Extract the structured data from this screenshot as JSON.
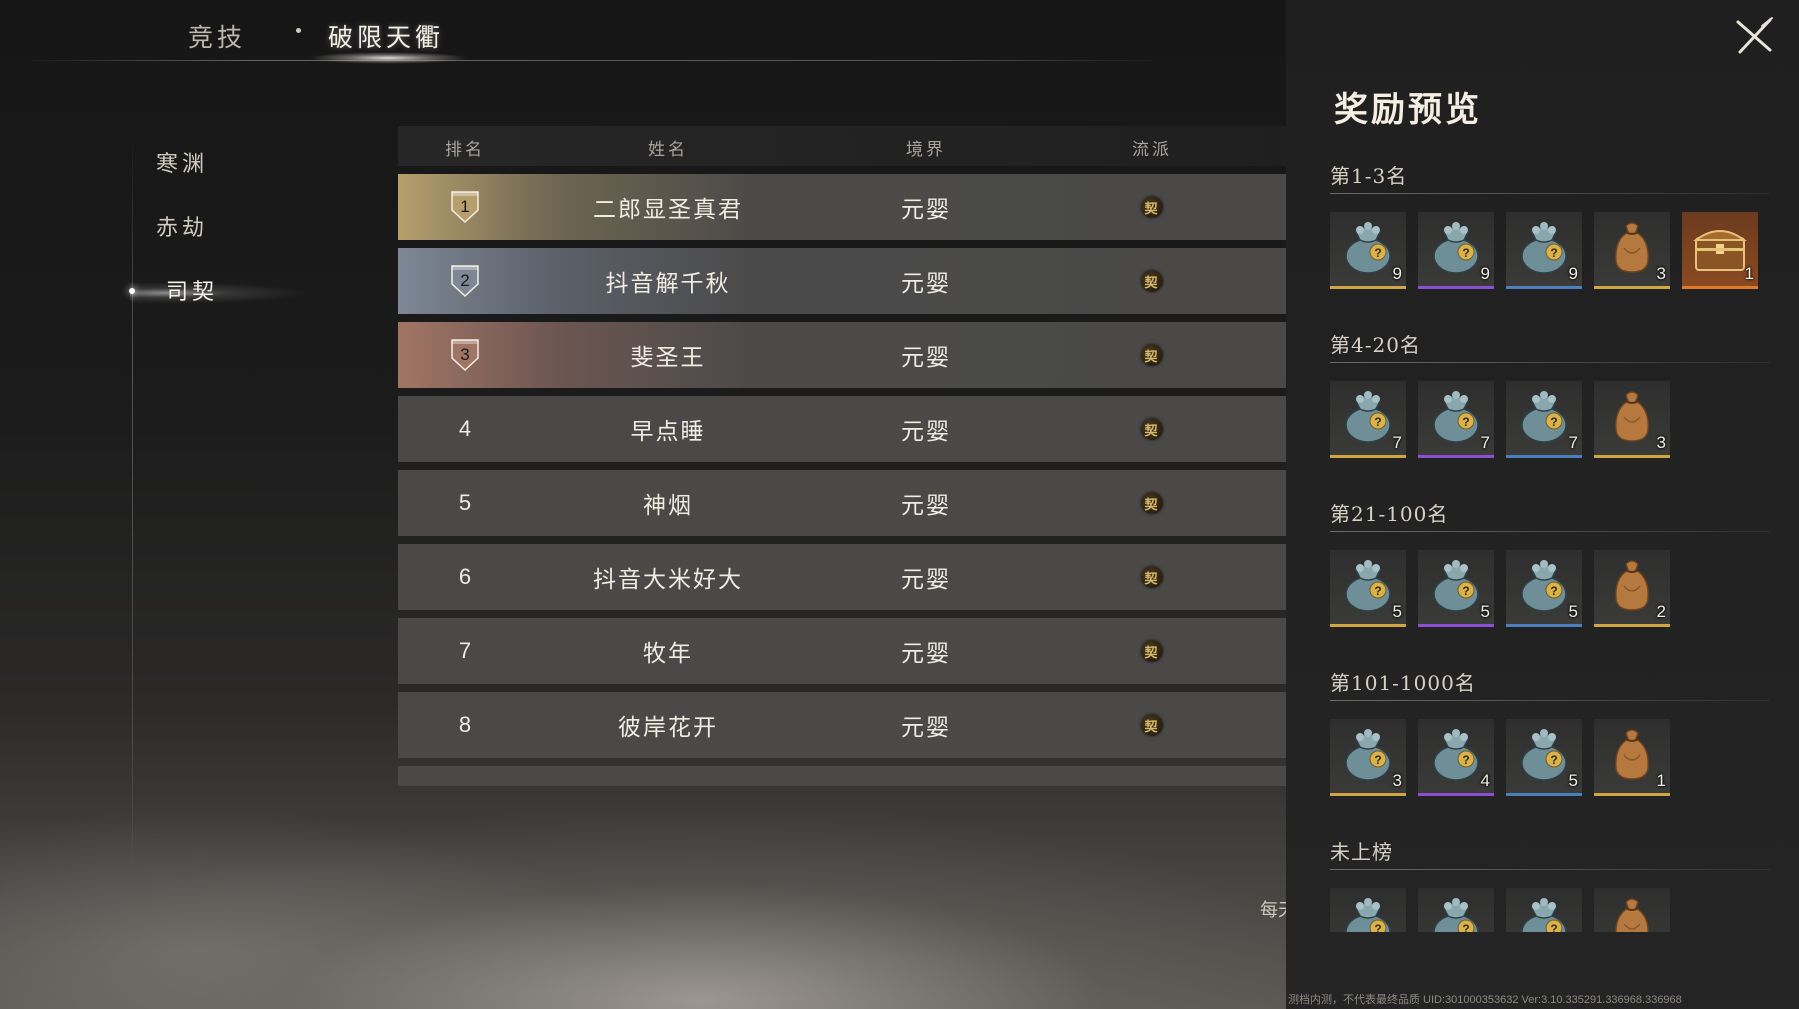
{
  "top_tabs": [
    {
      "label": "竞技"
    },
    {
      "label": "破限天衢"
    }
  ],
  "sidebar": {
    "items": [
      {
        "label": "寒渊"
      },
      {
        "label": "赤劫"
      },
      {
        "label": "司契"
      }
    ],
    "selected": "司契"
  },
  "table": {
    "headers": {
      "rank": "排名",
      "name": "姓名",
      "realm": "境界",
      "school": "流派"
    },
    "rows": [
      {
        "rank": "1",
        "name": "二郎显圣真君",
        "realm": "元婴",
        "school_icon": "契"
      },
      {
        "rank": "2",
        "name": "抖音解千秋",
        "realm": "元婴",
        "school_icon": "契"
      },
      {
        "rank": "3",
        "name": "斐圣王",
        "realm": "元婴",
        "school_icon": "契"
      },
      {
        "rank": "4",
        "name": "早点睡",
        "realm": "元婴",
        "school_icon": "契"
      },
      {
        "rank": "5",
        "name": "神烟",
        "realm": "元婴",
        "school_icon": "契"
      },
      {
        "rank": "6",
        "name": "抖音大米好大",
        "realm": "元婴",
        "school_icon": "契"
      },
      {
        "rank": "7",
        "name": "牧年",
        "realm": "元婴",
        "school_icon": "契"
      },
      {
        "rank": "8",
        "name": "彼岸花开",
        "realm": "元婴",
        "school_icon": "契"
      }
    ]
  },
  "daily_note": "每天",
  "reward_panel": {
    "title": "奖励预览",
    "tiers": [
      {
        "label": "第1-3名",
        "items": [
          {
            "type": "gold-bag",
            "quality": "gold",
            "count": "9"
          },
          {
            "type": "gold-bag",
            "quality": "purple",
            "count": "9"
          },
          {
            "type": "gold-bag",
            "quality": "blue",
            "count": "9"
          },
          {
            "type": "brown-bag",
            "quality": "gold",
            "count": "3"
          },
          {
            "type": "chest",
            "quality": "orange",
            "count": "1"
          }
        ]
      },
      {
        "label": "第4-20名",
        "items": [
          {
            "type": "gold-bag",
            "quality": "gold",
            "count": "7"
          },
          {
            "type": "gold-bag",
            "quality": "purple",
            "count": "7"
          },
          {
            "type": "gold-bag",
            "quality": "blue",
            "count": "7"
          },
          {
            "type": "brown-bag",
            "quality": "gold",
            "count": "3"
          }
        ]
      },
      {
        "label": "第21-100名",
        "items": [
          {
            "type": "gold-bag",
            "quality": "gold",
            "count": "5"
          },
          {
            "type": "gold-bag",
            "quality": "purple",
            "count": "5"
          },
          {
            "type": "gold-bag",
            "quality": "blue",
            "count": "5"
          },
          {
            "type": "brown-bag",
            "quality": "gold",
            "count": "2"
          }
        ]
      },
      {
        "label": "第101-1000名",
        "items": [
          {
            "type": "gold-bag",
            "quality": "gold",
            "count": "3"
          },
          {
            "type": "gold-bag",
            "quality": "purple",
            "count": "4"
          },
          {
            "type": "gold-bag",
            "quality": "blue",
            "count": "5"
          },
          {
            "type": "brown-bag",
            "quality": "gold",
            "count": "1"
          }
        ]
      },
      {
        "label": "未上榜",
        "items": [
          {
            "type": "gold-bag",
            "quality": "gold",
            "count": ""
          },
          {
            "type": "gold-bag",
            "quality": "purple",
            "count": ""
          },
          {
            "type": "gold-bag",
            "quality": "blue",
            "count": ""
          },
          {
            "type": "brown-bag",
            "quality": "gold",
            "count": ""
          }
        ]
      }
    ]
  },
  "footer": "测档内测，不代表最终品质 UID:301000353632 Ver:3.10.335291.336968.336968",
  "colors": {
    "rank1": "#b59f6d",
    "rank2": "#7d8795",
    "rank3": "#a17565",
    "quality_gold": "#d2a544",
    "quality_purple": "#8a4fd1",
    "quality_blue": "#4b7fbf",
    "quality_orange": "#e07a2a"
  }
}
